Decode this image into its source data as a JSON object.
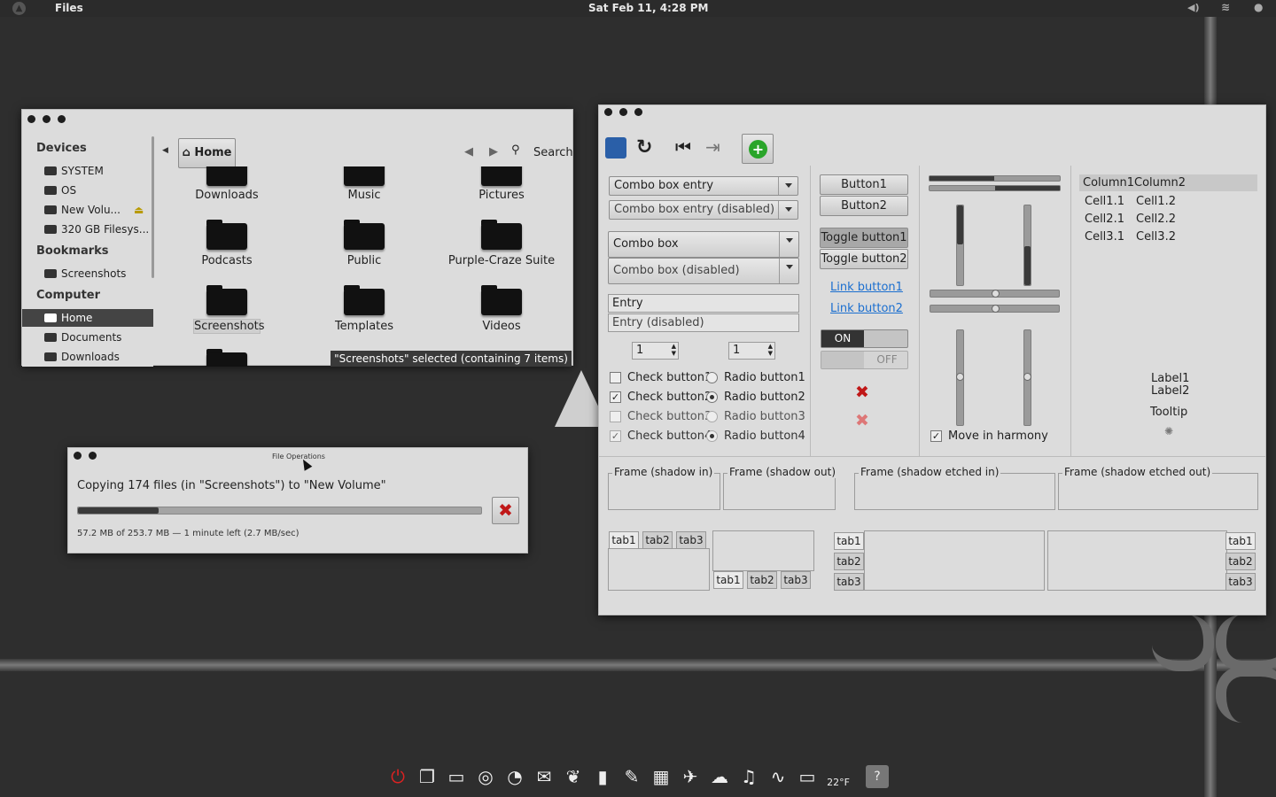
{
  "topbar": {
    "app_name": "Files",
    "clock": "Sat Feb 11,  4:28 PM",
    "weather": "22°F"
  },
  "files_window": {
    "sidebar": {
      "devices_header": "Devices",
      "devices": [
        "SYSTEM",
        "OS",
        "New Volu...",
        "320 GB Filesys..."
      ],
      "bookmarks_header": "Bookmarks",
      "bookmarks": [
        "Screenshots"
      ],
      "computer_header": "Computer",
      "computer": [
        "Home",
        "Documents",
        "Downloads"
      ]
    },
    "path_button": "Home",
    "search_label": "Search",
    "folders": [
      "Downloads",
      "Music",
      "Pictures",
      "Podcasts",
      "Public",
      "Purple-Craze Suite",
      "Screenshots",
      "Templates",
      "Videos"
    ],
    "status": "\"Screenshots\" selected (containing 7 items)"
  },
  "file_ops": {
    "title": "File Operations",
    "message": "Copying 174 files (in \"Screenshots\") to \"New Volume\"",
    "progress": 0.2,
    "detail": "57.2 MB of 253.7 MB — 1 minute left (2.7 MB/sec)"
  },
  "widgets": {
    "combo_entry": "Combo box entry",
    "combo_entry_disabled": "Combo box entry (disabled)",
    "combo": "Combo box",
    "combo_disabled": "Combo box (disabled)",
    "entry": "Entry",
    "entry_disabled": "Entry (disabled)",
    "spin1": "1",
    "spin2": "1",
    "checks": [
      "Check button1",
      "Check button2",
      "Check button3",
      "Check button4"
    ],
    "radios": [
      "Radio button1",
      "Radio button2",
      "Radio button3",
      "Radio button4"
    ],
    "button1": "Button1",
    "button2": "Button2",
    "toggle1": "Toggle button1",
    "toggle2": "Toggle button2",
    "link1": "Link button1",
    "link2": "Link button2",
    "switch_on": "ON",
    "switch_off": "OFF",
    "move_harmony": "Move in harmony",
    "tree_headers": [
      "Column1",
      "Column2"
    ],
    "tree_rows": [
      [
        "Cell1.1",
        "Cell1.2"
      ],
      [
        "Cell2.1",
        "Cell2.2"
      ],
      [
        "Cell3.1",
        "Cell3.2"
      ]
    ],
    "label1": "Label1",
    "label2": "Label2",
    "tooltip": "Tooltip",
    "frames": [
      "Frame (shadow in)",
      "Frame (shadow out)",
      "Frame (shadow etched in)",
      "Frame (shadow etched out)"
    ],
    "tabs": [
      "tab1",
      "tab2",
      "tab3"
    ]
  },
  "colors": {
    "accent_green": "#2aa52a",
    "close_red": "#c01818",
    "link_blue": "#1a6ecf"
  }
}
